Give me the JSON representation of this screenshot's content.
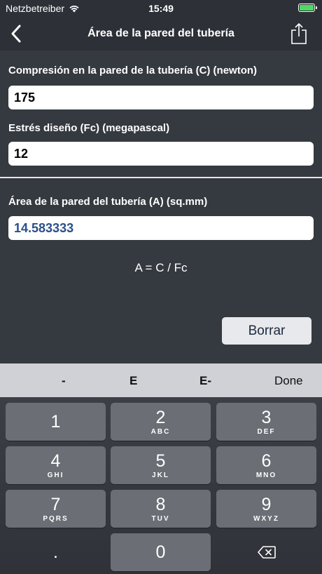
{
  "status_bar": {
    "carrier": "Netzbetreiber",
    "time": "15:49"
  },
  "nav": {
    "title": "Área de la pared del tubería"
  },
  "fields": {
    "compression": {
      "label": "Compresión en la pared de la tubería (C) (newton)",
      "value": "175"
    },
    "stress": {
      "label": "Estrés diseño (Fc) (megapascal)",
      "value": "12"
    },
    "area": {
      "label": "Área de la pared del tubería (A) (sq.mm)",
      "value": "14.583333"
    }
  },
  "formula": "A = C / Fc",
  "clear_label": "Borrar",
  "accessory": {
    "minus": "-",
    "e": "E",
    "e_minus": "E-",
    "done": "Done"
  },
  "keypad": {
    "keys": [
      {
        "digit": "1",
        "letters": ""
      },
      {
        "digit": "2",
        "letters": "ABC"
      },
      {
        "digit": "3",
        "letters": "DEF"
      },
      {
        "digit": "4",
        "letters": "GHI"
      },
      {
        "digit": "5",
        "letters": "JKL"
      },
      {
        "digit": "6",
        "letters": "MNO"
      },
      {
        "digit": "7",
        "letters": "PQRS"
      },
      {
        "digit": "8",
        "letters": "TUV"
      },
      {
        "digit": "9",
        "letters": "WXYZ"
      },
      {
        "digit": "0",
        "letters": ""
      }
    ],
    "decimal": "."
  },
  "colors": {
    "background": "#353940",
    "result_text": "#2b4f8a",
    "battery": "#4cd964"
  }
}
